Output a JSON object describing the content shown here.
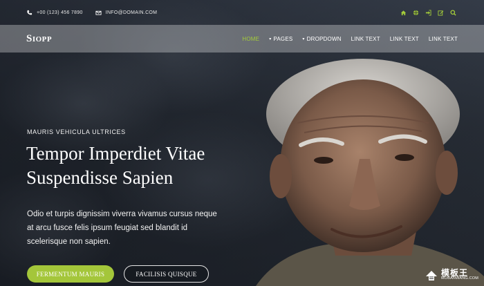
{
  "colors": {
    "accent": "#a4cc3a",
    "button_primary": "#a4c63a"
  },
  "topbar": {
    "phone": "+00 (123) 456 7890",
    "email": "INFO@DOMAIN.COM",
    "icons": [
      "phone-icon",
      "envelope-icon",
      "home-icon",
      "globe-icon",
      "sign-in-icon",
      "edit-icon",
      "search-icon"
    ]
  },
  "brand": {
    "logo_first": "S",
    "logo_rest": "IOPP"
  },
  "nav": {
    "items": [
      {
        "label": "HOME",
        "active": true
      },
      {
        "label": "PAGES",
        "dropdown": true
      },
      {
        "label": "DROPDOWN",
        "dropdown": true
      },
      {
        "label": "LINK TEXT"
      },
      {
        "label": "LINK TEXT"
      },
      {
        "label": "LINK TEXT"
      }
    ]
  },
  "hero": {
    "kicker": "MAURIS VEHICULA ULTRICES",
    "title_line1": "Tempor Imperdiet Vitae",
    "title_line2": "Suspendisse Sapien",
    "lead_line1": "Odio et turpis dignissim viverra vivamus cursus neque",
    "lead_line2": "at arcu fusce felis ipsum feugiat sed blandit id",
    "lead_line3": "scelerisque non sapien.",
    "primary_button": "FERMENTUM MAURIS",
    "secondary_button": "FACILISIS QUISQUE"
  },
  "watermark": {
    "text": "模板王",
    "url": "MOBANWANG.COM"
  }
}
